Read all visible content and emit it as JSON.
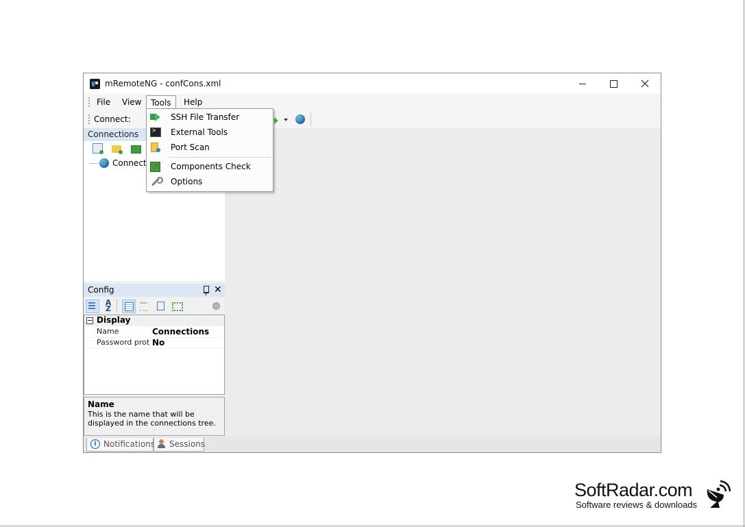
{
  "window": {
    "title": "mRemoteNG - confCons.xml",
    "controls": {
      "minimize": "minimize",
      "maximize": "maximize",
      "close": "close"
    }
  },
  "menubar": {
    "items": [
      {
        "label": "File"
      },
      {
        "label": "View"
      },
      {
        "label": "Tools",
        "open": true
      },
      {
        "label": "Help"
      }
    ]
  },
  "toolbar": {
    "connect_label": "Connect:"
  },
  "tools_menu": {
    "items": [
      {
        "label": "SSH File Transfer",
        "icon": "ssh-transfer-icon"
      },
      {
        "label": "External Tools",
        "icon": "terminal-icon"
      },
      {
        "label": "Port Scan",
        "icon": "port-scan-icon"
      },
      {
        "label": "Components Check",
        "icon": "components-check-icon"
      },
      {
        "label": "Options",
        "icon": "wrench-icon"
      }
    ]
  },
  "connections_panel": {
    "title": "Connections",
    "tree": [
      {
        "label": "Connectio",
        "icon": "globe-icon"
      }
    ],
    "search": {
      "value": "",
      "placeholder": ""
    }
  },
  "config_panel": {
    "title": "Config",
    "category": "Display",
    "properties": [
      {
        "name": "Name",
        "value": "Connections"
      },
      {
        "name": "Password prote",
        "value": "No"
      }
    ],
    "description": {
      "title": "Name",
      "text": "This is the name that will be displayed in the connections tree."
    }
  },
  "bottom_tabs": [
    {
      "label": "Notifications",
      "icon": "info-icon"
    },
    {
      "label": "Sessions",
      "icon": "sessions-icon"
    }
  ],
  "watermark": {
    "brand": "SoftRadar.com",
    "tagline": "Software reviews & downloads"
  },
  "colors": {
    "panel_header": "#dbe6f4",
    "menu_bg": "#fcfcfc",
    "content_bg": "#ececec"
  }
}
